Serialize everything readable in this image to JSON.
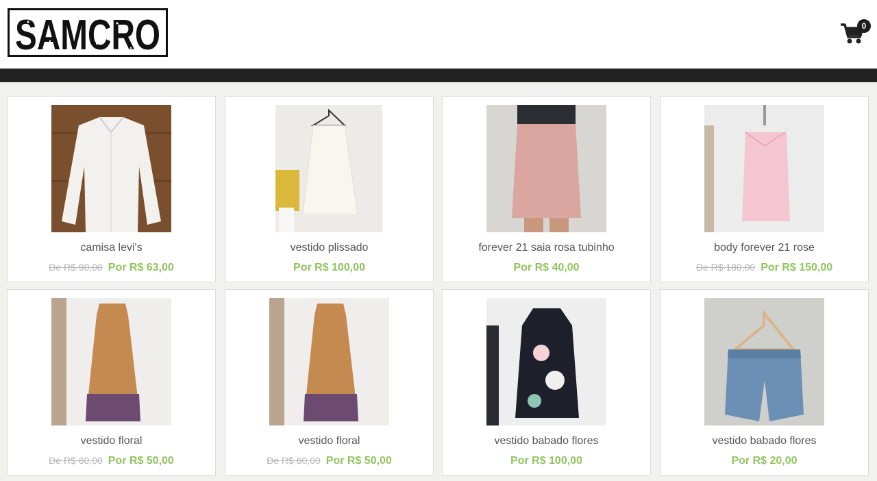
{
  "header": {
    "logo_text": "SAMCRO",
    "cart_count": "0",
    "cart_icon": "shopping-cart-icon"
  },
  "products": [
    {
      "name": "camisa levi's",
      "old_price": "De R$ 90,00",
      "price": "Por R$ 63,00"
    },
    {
      "name": "vestido plissado",
      "old_price": "",
      "price": "Por R$ 100,00"
    },
    {
      "name": "forever 21 saia rosa tubinho",
      "old_price": "",
      "price": "Por R$ 40,00"
    },
    {
      "name": "body forever 21 rose",
      "old_price": "De R$ 180,00",
      "price": "Por R$ 150,00"
    },
    {
      "name": "vestido floral",
      "old_price": "De R$ 60,00",
      "price": "Por R$ 50,00"
    },
    {
      "name": "vestido floral",
      "old_price": "De R$ 60,00",
      "price": "Por R$ 50,00"
    },
    {
      "name": "vestido babado flores",
      "old_price": "",
      "price": "Por R$ 100,00"
    },
    {
      "name": "vestido babado flores",
      "old_price": "",
      "price": "Por R$ 20,00"
    }
  ],
  "colors": {
    "price_green": "#8fc45e",
    "old_price_gray": "#b4b4b4",
    "navbar": "#222222",
    "background": "#f1f1f0"
  }
}
